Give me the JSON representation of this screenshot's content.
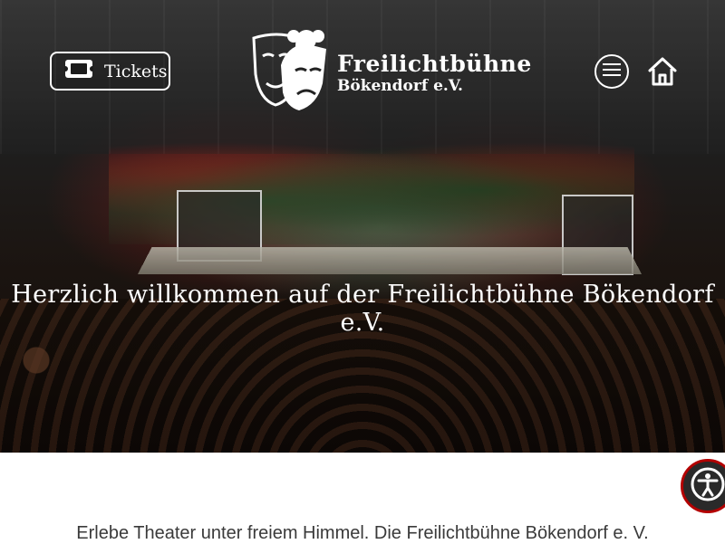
{
  "header": {
    "tickets_label": "Tickets",
    "logo": {
      "title": "Freilichtbühne",
      "subtitle": "Bökendorf e.V."
    },
    "menu_icon": "hamburger-menu-icon",
    "home_icon": "home-icon"
  },
  "hero": {
    "welcome_text": "Herzlich willkommen auf der Freilichtbühne Bökendorf e.V."
  },
  "content": {
    "intro_text": "Erlebe Theater unter freiem Himmel. Die Freilichtbühne Bökendorf e. V."
  },
  "accessibility": {
    "icon": "accessibility-icon"
  },
  "colors": {
    "text_on_hero": "#ffffff",
    "body_text": "#3a3a3a",
    "accessibility_ring": "#b30000"
  }
}
